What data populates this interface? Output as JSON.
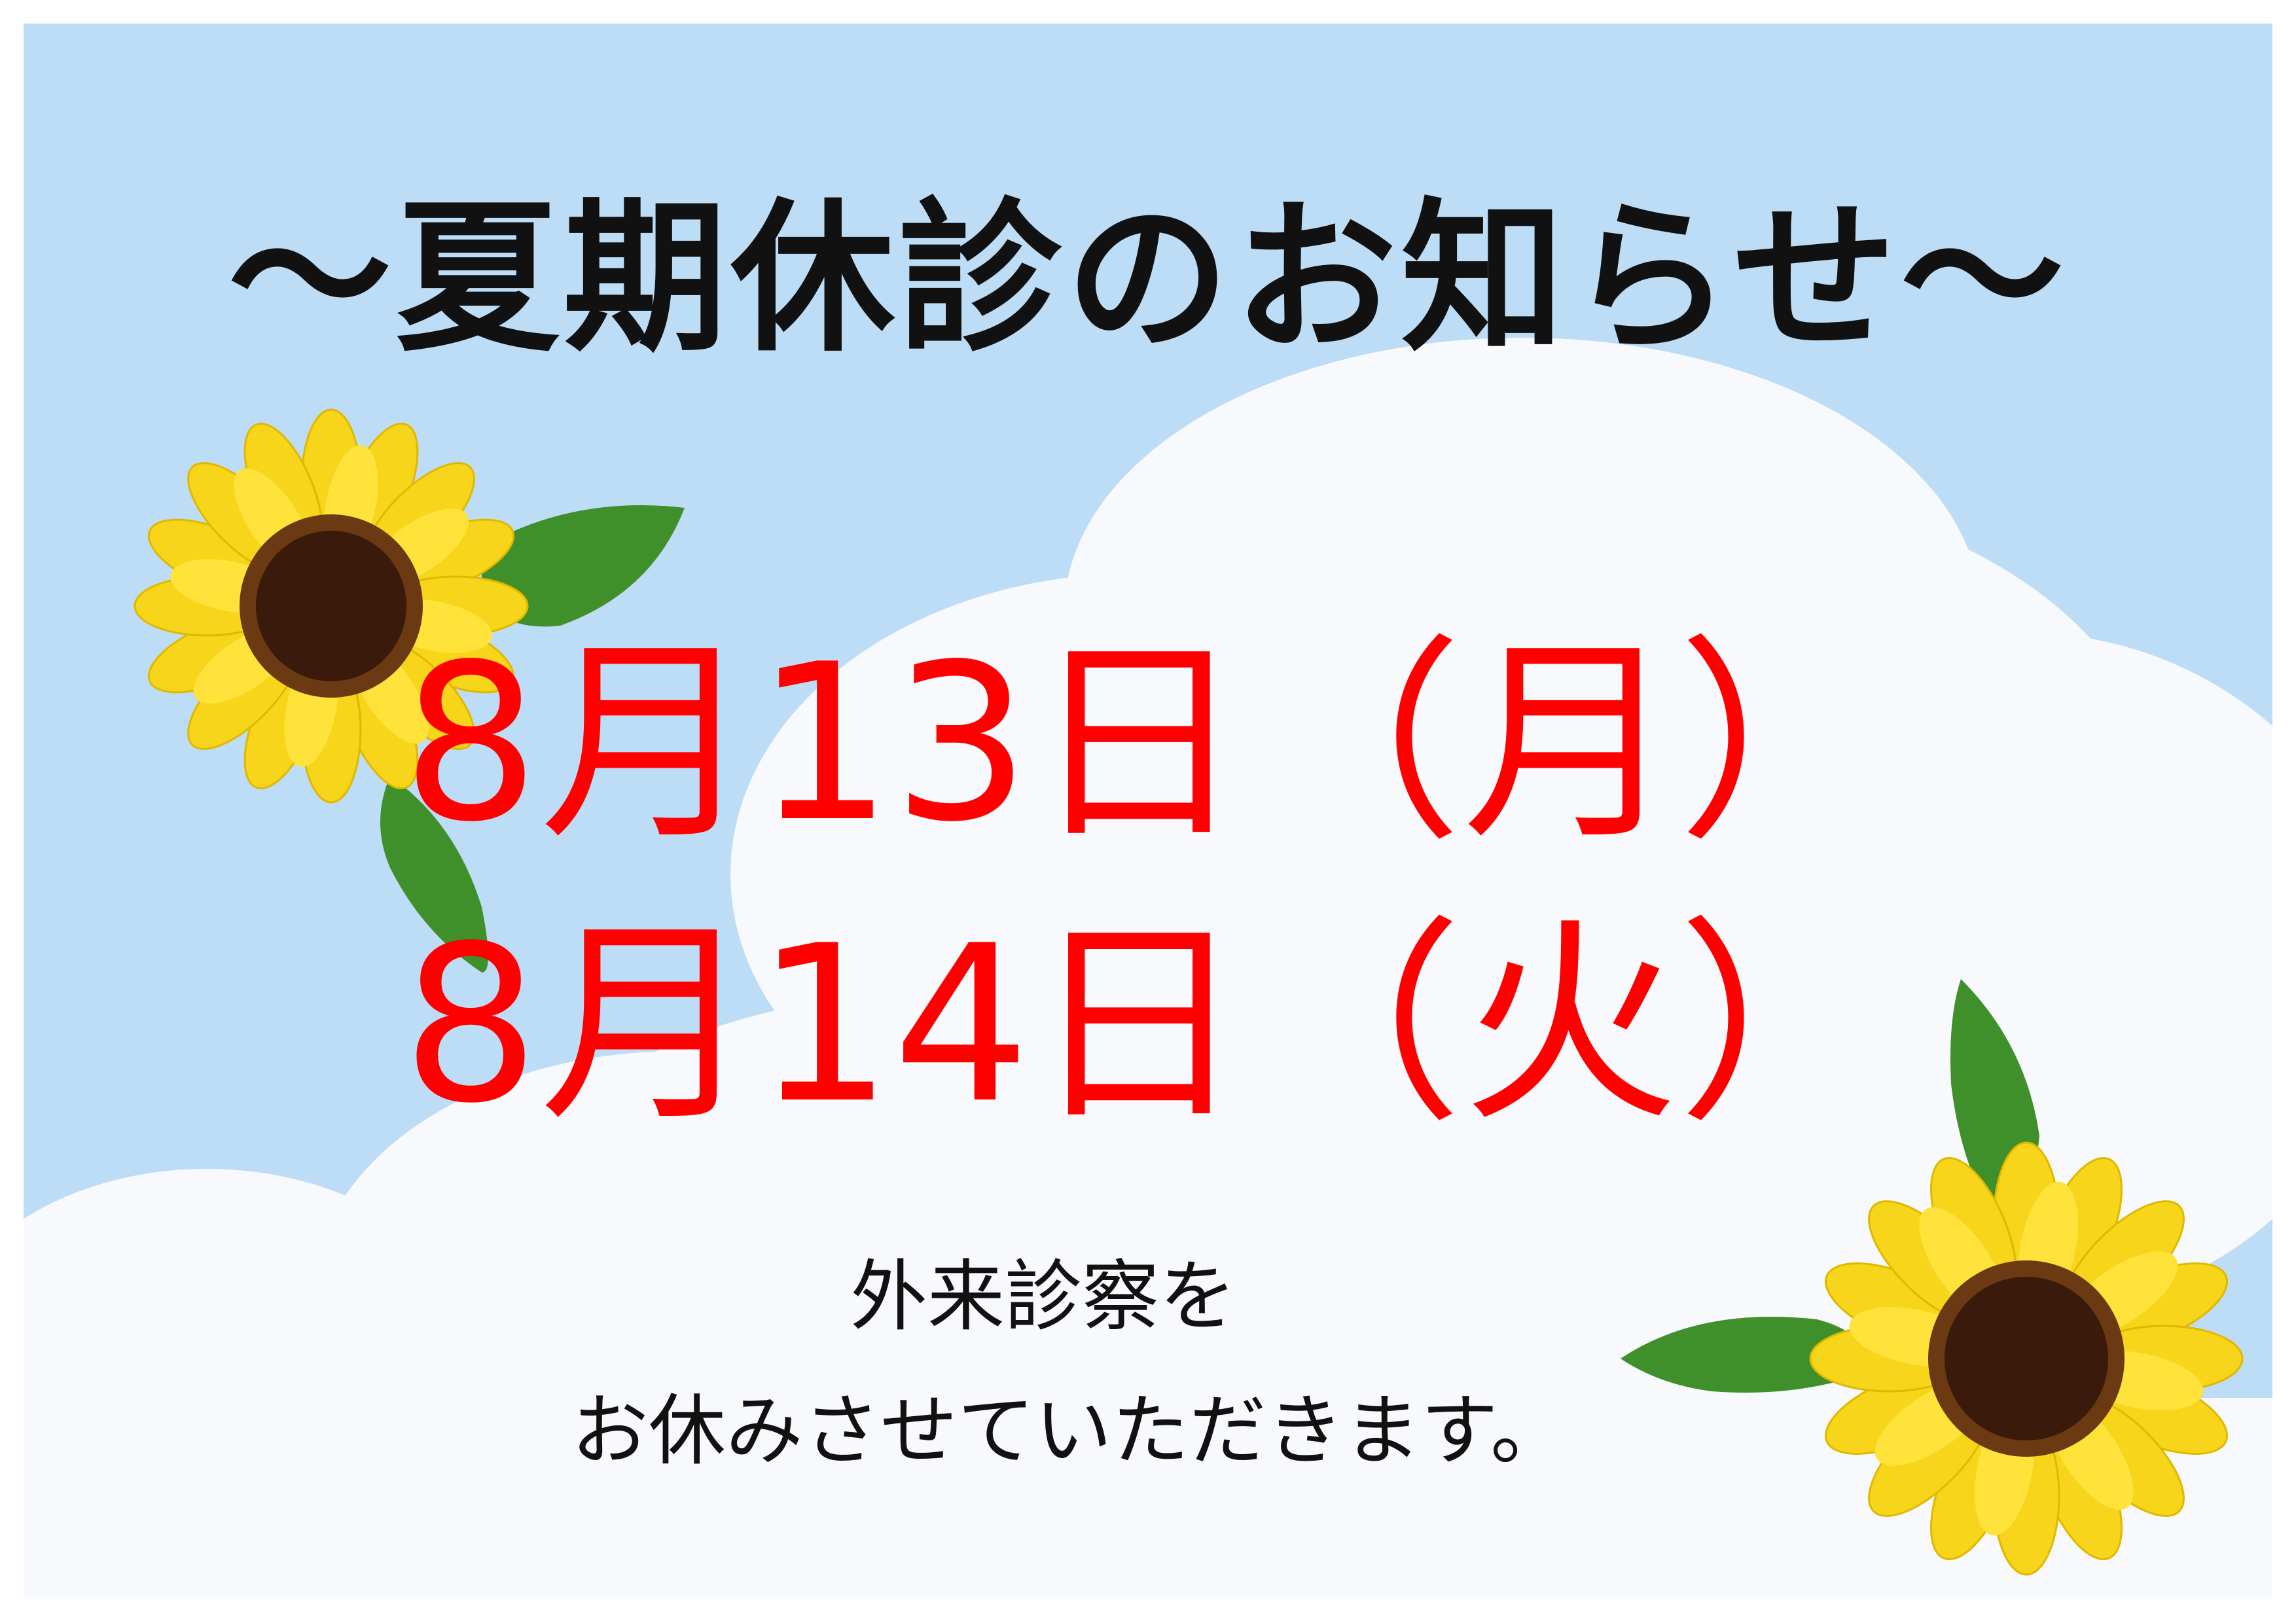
{
  "notice": {
    "title": "～夏期休診のお知らせ～",
    "dates": [
      "8月13日（月）",
      "8月14日（火）"
    ],
    "message_lines": [
      "外来診察を",
      "お休みさせていただきます。"
    ]
  },
  "colors": {
    "sky": "#bddcf6",
    "cloud": "#f7f9fc",
    "title_text": "#111111",
    "date_text": "#ff0000",
    "petal": "#f7d51a",
    "flower_center": "#3a1a0a",
    "leaf": "#3f8f2a"
  },
  "decorations": {
    "flowers": [
      "sunflower-icon",
      "sunflower-icon"
    ],
    "background": "sky-with-clouds"
  }
}
